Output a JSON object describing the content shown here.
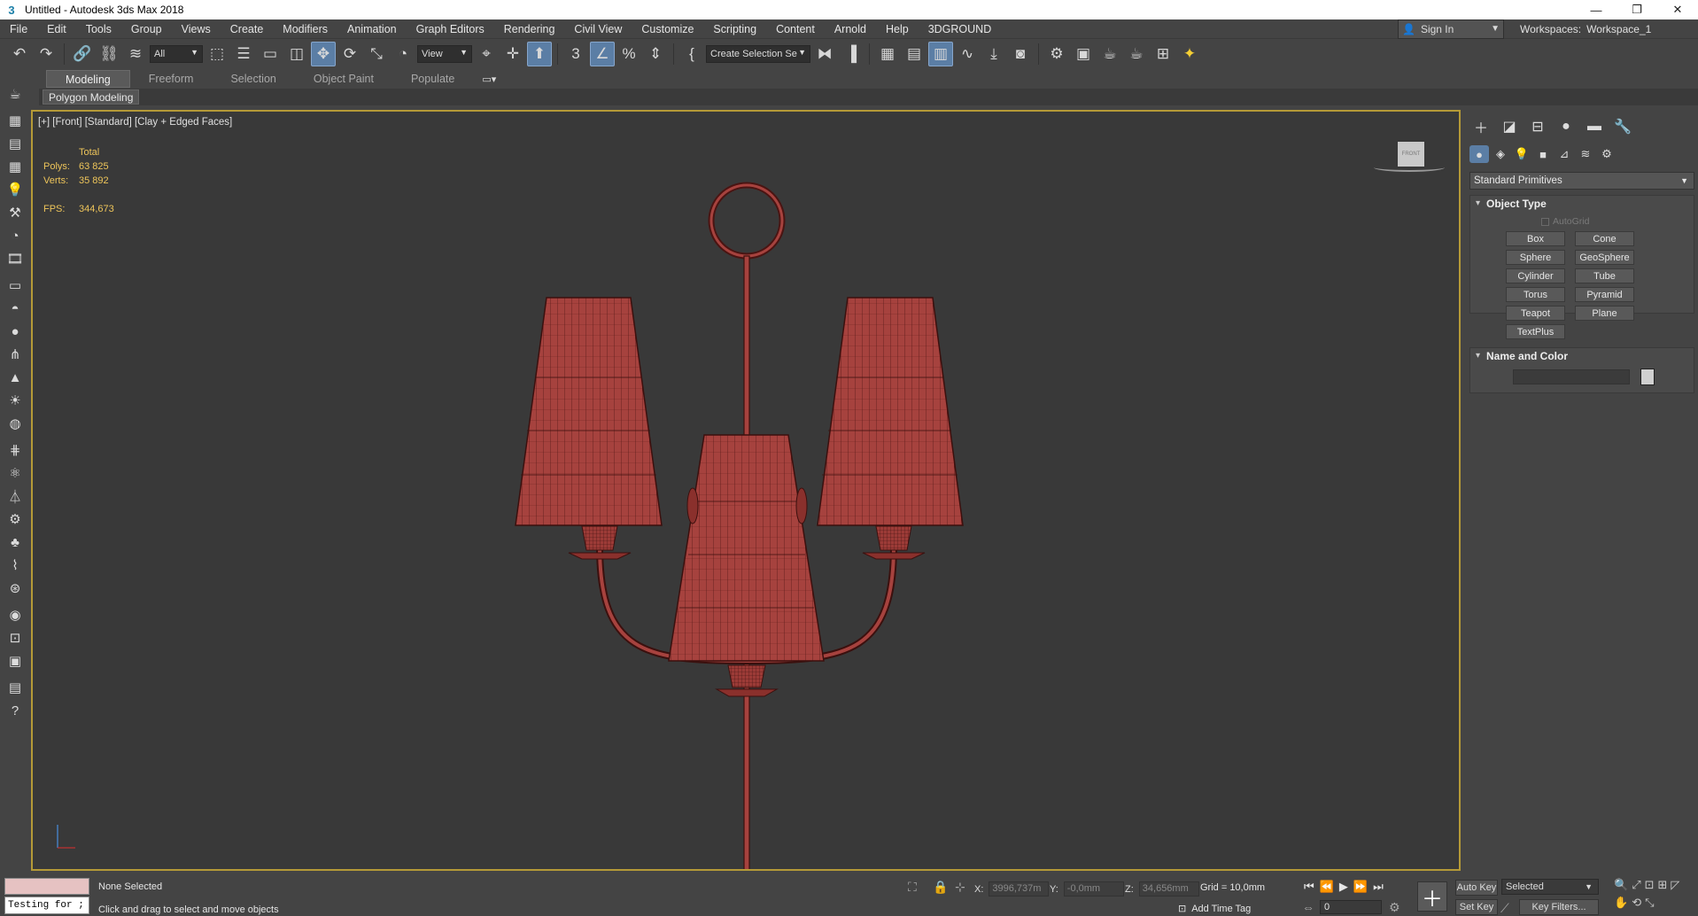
{
  "window": {
    "title": "Untitled - Autodesk 3ds Max 2018",
    "controls": [
      "—",
      "❐",
      "✕"
    ]
  },
  "menu": [
    "File",
    "Edit",
    "Tools",
    "Group",
    "Views",
    "Create",
    "Modifiers",
    "Animation",
    "Graph Editors",
    "Rendering",
    "Civil View",
    "Customize",
    "Scripting",
    "Content",
    "Arnold",
    "Help",
    "3DGROUND"
  ],
  "account": {
    "sign_in": "Sign In",
    "workspaces_label": "Workspaces:",
    "workspace_value": "Workspace_1"
  },
  "toolbar": {
    "filter_value": "All",
    "ref_coord_value": "View",
    "selection_set_value": "Create Selection Se"
  },
  "ribbon": {
    "tabs": [
      "Modeling",
      "Freeform",
      "Selection",
      "Object Paint",
      "Populate"
    ],
    "active_tab": "Modeling",
    "sub_panel": "Polygon Modeling"
  },
  "viewport": {
    "label": "[+] [Front] [Standard] [Clay + Edged Faces]",
    "stats": {
      "total_label": "Total",
      "polys_label": "Polys:",
      "polys_value": "63 825",
      "verts_label": "Verts:",
      "verts_value": "35 892",
      "fps_label": "FPS:",
      "fps_value": "344,673"
    },
    "viewcube_label": "FRONT",
    "model_color": "#a6423e",
    "frame_color": "#b59a37"
  },
  "command_panel": {
    "dropdown": "Standard Primitives",
    "object_type": {
      "title": "Object Type",
      "autogrid": "AutoGrid",
      "buttons": [
        "Box",
        "Cone",
        "Sphere",
        "GeoSphere",
        "Cylinder",
        "Tube",
        "Torus",
        "Pyramid",
        "Teapot",
        "Plane",
        "TextPlus"
      ]
    },
    "name_and_color": {
      "title": "Name and Color"
    }
  },
  "status": {
    "listener_text": "Testing for ;",
    "selection_status": "None Selected",
    "prompt": "Click and drag to select and move objects",
    "x_label": "X:",
    "x_value": "3996,737m",
    "y_label": "Y:",
    "y_value": "-0,0mm",
    "z_label": "Z:",
    "z_value": "34,656mm",
    "grid": "Grid = 10,0mm",
    "add_time_tag": "Add Time Tag",
    "frame": "0",
    "auto_key": "Auto Key",
    "set_key": "Set Key",
    "key_mode": "Selected",
    "key_filters": "Key Filters..."
  }
}
